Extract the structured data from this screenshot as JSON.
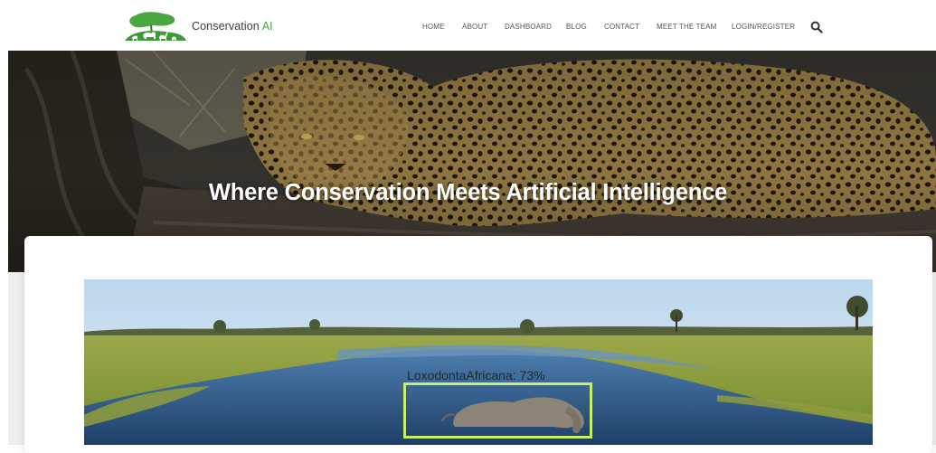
{
  "brand": {
    "name_main": "Conservation",
    "name_suffix": "AI",
    "logo_icon": "acacia-animals-logo-icon",
    "accent_color": "#3daa3a"
  },
  "nav": {
    "items": [
      {
        "label": "HOME"
      },
      {
        "label": "ABOUT"
      },
      {
        "label": "DASHBOARD"
      },
      {
        "label": "BLOG"
      },
      {
        "label": "CONTACT"
      },
      {
        "label": "MEET THE TEAM"
      },
      {
        "label": "LOGIN/REGISTER"
      }
    ],
    "search_icon": "search-icon"
  },
  "hero": {
    "title": "Where Conservation Meets Artificial Intelligence",
    "background": "leopard-on-tree-photo"
  },
  "detection": {
    "label": "LoxodontaAfricana: 73%",
    "box_color": "#c6f06a",
    "image": "elephant-in-river-photo"
  }
}
